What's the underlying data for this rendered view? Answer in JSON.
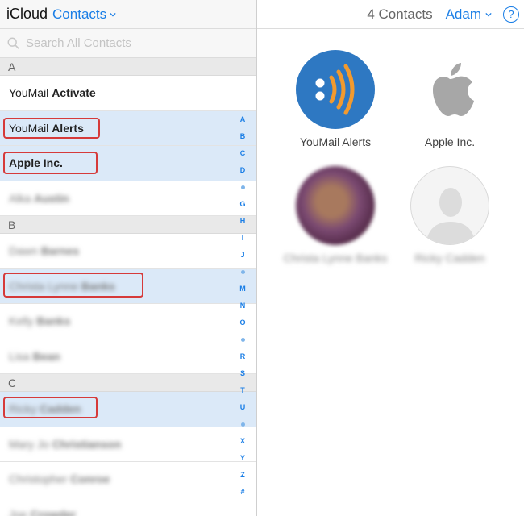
{
  "header": {
    "app_name": "iCloud",
    "section": "Contacts",
    "contact_count": "4 Contacts",
    "user_name": "Adam",
    "help_label": "?"
  },
  "search": {
    "placeholder": "Search All Contacts"
  },
  "sections": [
    {
      "letter": "A"
    },
    {
      "letter": "B"
    },
    {
      "letter": "C"
    }
  ],
  "contacts": [
    {
      "prefix": "YouMail ",
      "suffix": "Activate",
      "blurred": false
    },
    {
      "prefix": "YouMail ",
      "suffix": "Alerts",
      "blurred": false
    },
    {
      "prefix": "",
      "suffix": "Apple Inc.",
      "blurred": false
    },
    {
      "prefix": "Alka ",
      "suffix": "Austin",
      "blurred": true
    },
    {
      "prefix": "Dawn ",
      "suffix": "Barnes",
      "blurred": true
    },
    {
      "prefix": "Christa Lynne ",
      "suffix": "Banks",
      "blurred": true
    },
    {
      "prefix": "Kelly ",
      "suffix": "Banks",
      "blurred": true
    },
    {
      "prefix": "Lisa ",
      "suffix": "Bean",
      "blurred": true
    },
    {
      "prefix": "Ricky ",
      "suffix": "Cadden",
      "blurred": true
    },
    {
      "prefix": "Mary Jo ",
      "suffix": "Christianson",
      "blurred": true
    },
    {
      "prefix": "Christopher ",
      "suffix": "Conroe",
      "blurred": true
    },
    {
      "prefix": "Joe ",
      "suffix": "Crowder",
      "blurred": true
    }
  ],
  "index_letters": [
    "A",
    "B",
    "C",
    "D",
    "•",
    "G",
    "H",
    "I",
    "J",
    "•",
    "M",
    "N",
    "O",
    "•",
    "R",
    "S",
    "T",
    "U",
    "•",
    "X",
    "Y",
    "Z",
    "#"
  ],
  "cards": [
    {
      "name": "YouMail Alerts",
      "avatar": "youmail-logo",
      "blurred": false
    },
    {
      "name": "Apple Inc.",
      "avatar": "apple-logo",
      "blurred": false
    },
    {
      "name": "Christa Lynne Banks",
      "avatar": "photo",
      "blurred": true
    },
    {
      "name": "Ricky Cadden",
      "avatar": "person-silhouette",
      "blurred": true
    }
  ],
  "colors": {
    "accent": "#1a7ee6",
    "selected_row": "#dbe9f8",
    "annotation": "#d63a3a",
    "youmail_blue": "#2e78c2",
    "youmail_orange": "#f29a2e"
  }
}
